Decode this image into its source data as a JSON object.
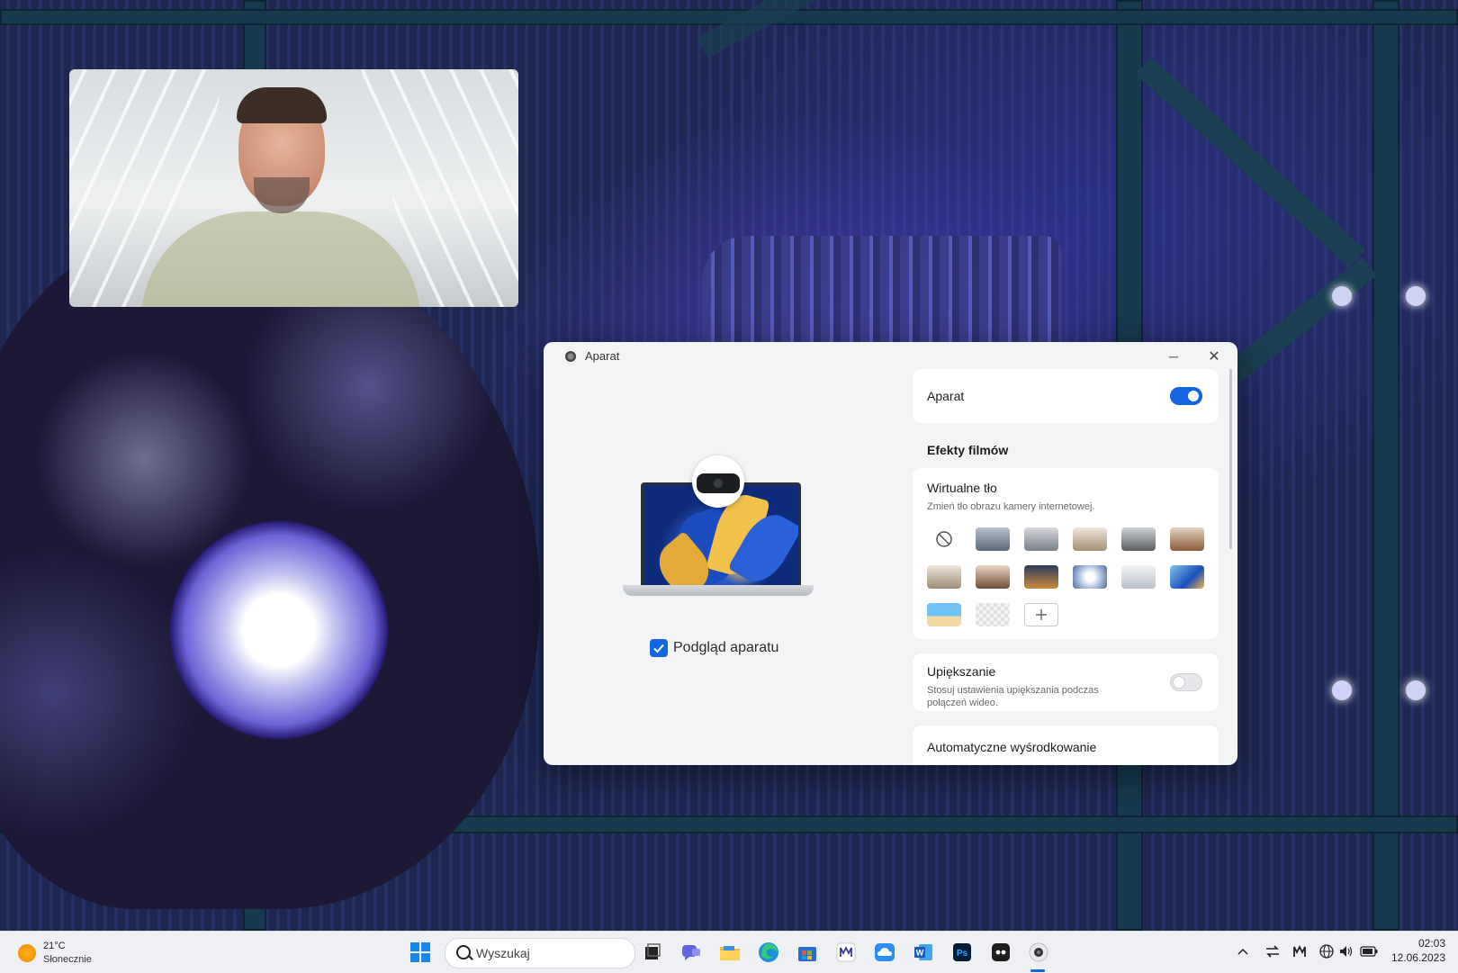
{
  "camera_window": {
    "title": "Aparat",
    "minimize_label": "─",
    "close_label": "✕",
    "preview_checkbox_label": "Podgląd aparatu",
    "preview_checked": true,
    "camera_toggle": {
      "label": "Aparat",
      "state": "on"
    },
    "effects_heading": "Efekty filmów",
    "virtual_background": {
      "title": "Wirtualne tło",
      "subtitle": "Zmień tło obrazu kamery internetowej.",
      "options": [
        {
          "name": "none",
          "icon": "no-background-icon"
        },
        {
          "name": "room-1"
        },
        {
          "name": "room-2"
        },
        {
          "name": "room-3"
        },
        {
          "name": "room-4"
        },
        {
          "name": "room-5"
        },
        {
          "name": "room-6"
        },
        {
          "name": "room-7"
        },
        {
          "name": "city-night"
        },
        {
          "name": "light-circle"
        },
        {
          "name": "clouds"
        },
        {
          "name": "blue-abstract"
        },
        {
          "name": "beach"
        },
        {
          "name": "blur"
        },
        {
          "name": "add",
          "icon": "plus-icon"
        }
      ]
    },
    "beautify": {
      "title": "Upiększanie",
      "subtitle_line1": "Stosuj ustawienia upiększania podczas",
      "subtitle_line2": "połączeń wideo.",
      "state": "off"
    },
    "auto_center_title": "Automatyczne wyśrodkowanie"
  },
  "taskbar": {
    "weather_temp": "21°C",
    "weather_condition": "Słonecznie",
    "search_placeholder": "Wyszukaj",
    "pinned_apps": [
      "windows-start-icon",
      "task-view-icon",
      "chat-icon",
      "file-explorer-icon",
      "edge-icon",
      "store-icon",
      "huawei-pc-manager-icon",
      "cloud-icon",
      "word-icon",
      "photoshop-icon",
      "app-icon",
      "camera-app-icon"
    ],
    "clock_time": "02:03",
    "clock_date": "12.06.2023"
  },
  "colors": {
    "accent": "#1565e0",
    "window_bg": "#f3f4f6",
    "taskbar_bg": "#eef0f4"
  }
}
